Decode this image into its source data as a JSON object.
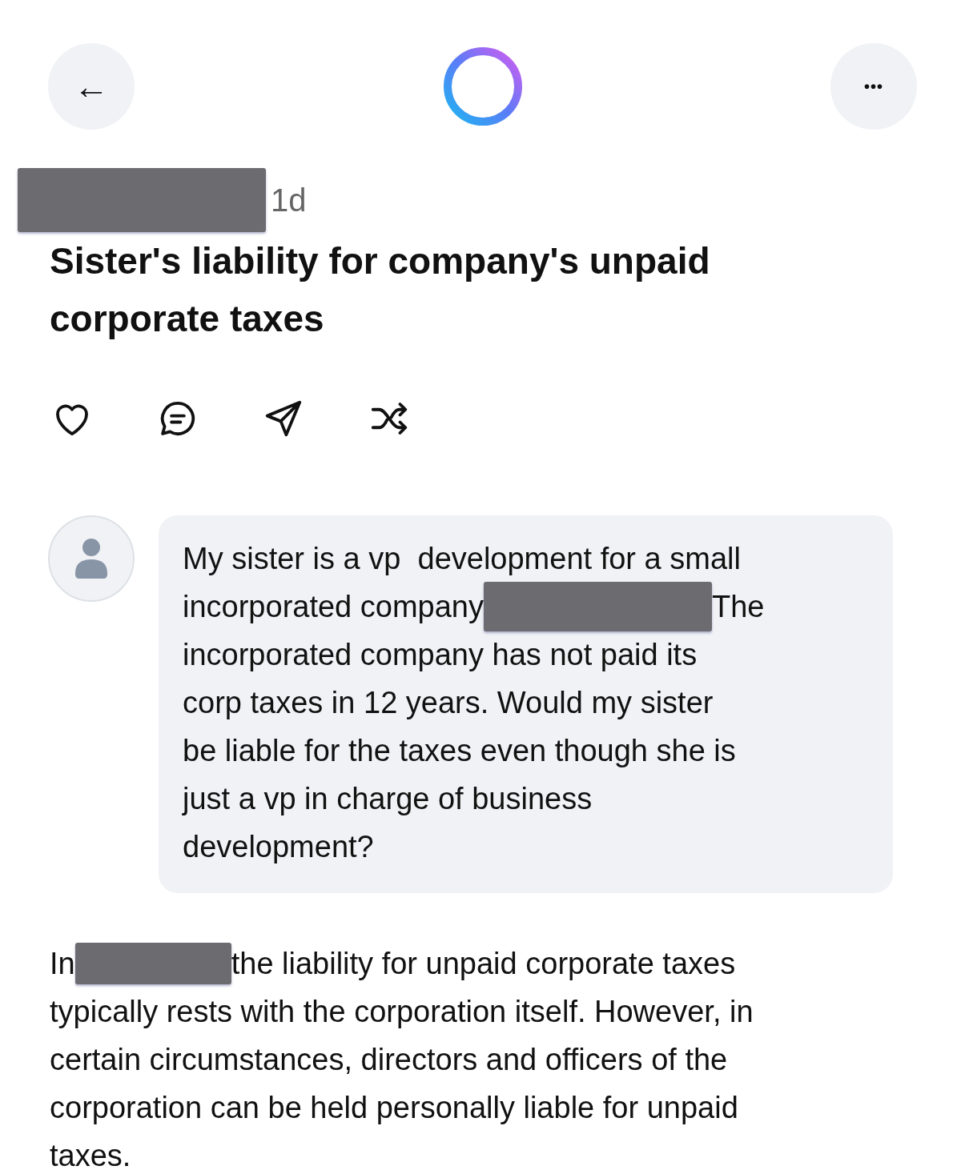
{
  "header": {
    "back_button": "←",
    "more_button": "•••"
  },
  "post": {
    "author_redacted": true,
    "age": "1d",
    "title": "Sister's liability for company's unpaid corporate taxes"
  },
  "actions": [
    {
      "kind": "like"
    },
    {
      "kind": "comment"
    },
    {
      "kind": "share"
    },
    {
      "kind": "remix"
    }
  ],
  "question": {
    "lines": [
      [
        {
          "kind": "text",
          "text": "My sister is a vp  development for a small"
        }
      ],
      [
        {
          "kind": "text",
          "text": "incorporated company"
        },
        {
          "kind": "redaction"
        },
        {
          "kind": "text",
          "text": "The"
        }
      ],
      [
        {
          "kind": "text",
          "text": "incorporated company has not paid its"
        }
      ],
      [
        {
          "kind": "text",
          "text": "corp taxes in 12 years. Would my sister"
        }
      ],
      [
        {
          "kind": "text",
          "text": "be liable for the taxes even though she is"
        }
      ],
      [
        {
          "kind": "text",
          "text": "just a vp in charge of business"
        }
      ],
      [
        {
          "kind": "text",
          "text": "development?"
        }
      ]
    ]
  },
  "answer": {
    "lines": [
      [
        {
          "kind": "text",
          "text": "In"
        },
        {
          "kind": "redaction"
        },
        {
          "kind": "text",
          "text": "the liability for unpaid corporate taxes"
        }
      ],
      [
        {
          "kind": "text",
          "text": "typically rests with the corporation itself. However, in"
        }
      ],
      [
        {
          "kind": "text",
          "text": "certain circumstances, directors and officers of the"
        }
      ],
      [
        {
          "kind": "text",
          "text": "corporation can be held personally liable for unpaid"
        }
      ],
      [
        {
          "kind": "text",
          "text": "taxes."
        }
      ]
    ]
  }
}
